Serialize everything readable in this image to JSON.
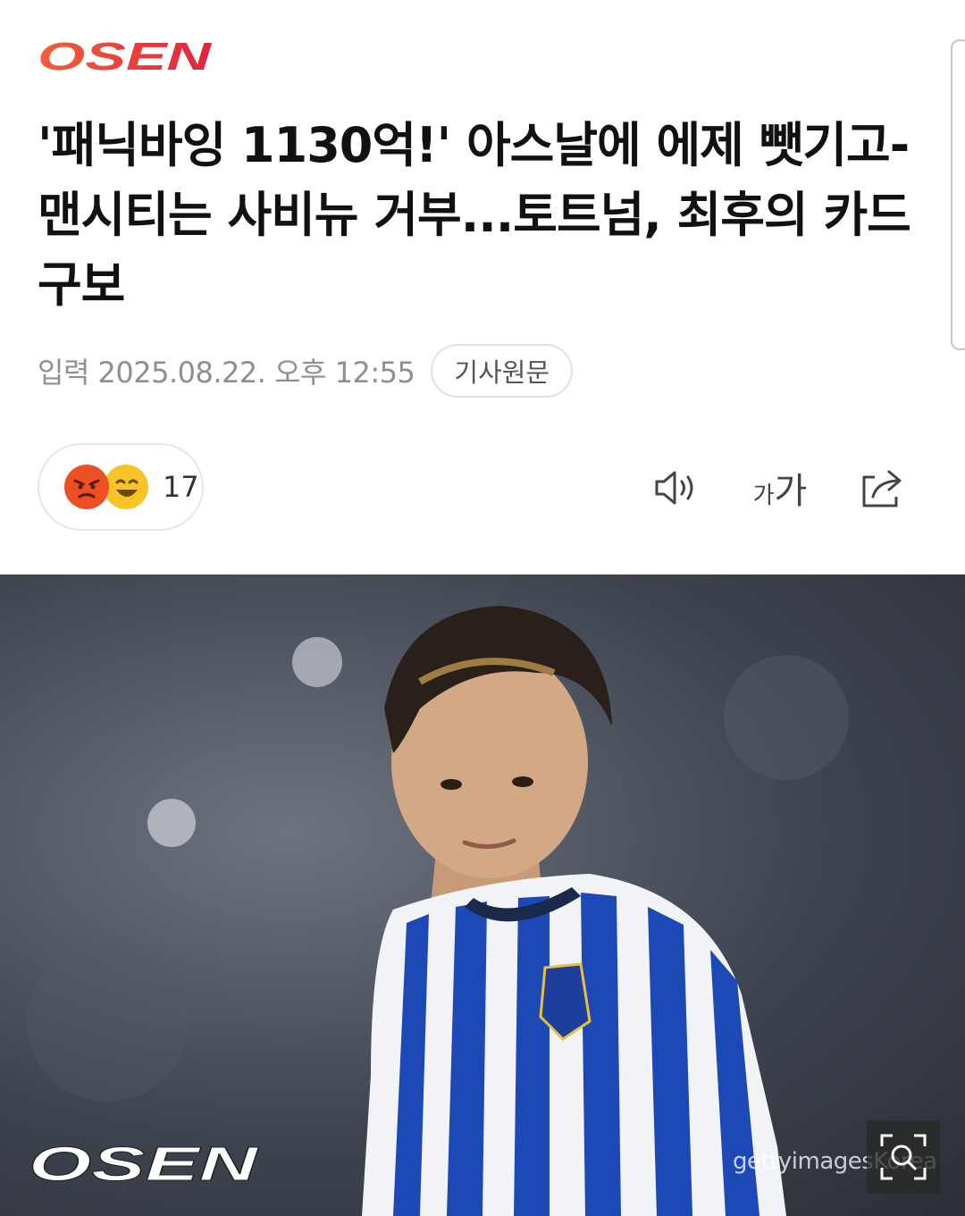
{
  "brand": {
    "name": "OSEN",
    "color": "#e8343b",
    "icon": "osen-logo"
  },
  "article": {
    "headline": "'패닉바잉 1130억!' 아스날에 에제 뺏기고-맨시티는 사비뉴 거부...토트넘, 최후의 카드 구보",
    "published": "입력 2025.08.22. 오후 12:55",
    "original_link_label": "기사원문"
  },
  "reactions": {
    "count": "17",
    "icons": [
      "angry-emoji-icon",
      "laughing-emoji-icon"
    ]
  },
  "toolbar": {
    "icons": [
      "speaker-icon",
      "font-size-icon",
      "share-icon"
    ],
    "font_small": "가",
    "font_large": "가"
  },
  "photo": {
    "watermark": "OSEN",
    "credit": "gettyimagesKorea",
    "zoom_icon": "zoom-icon"
  }
}
